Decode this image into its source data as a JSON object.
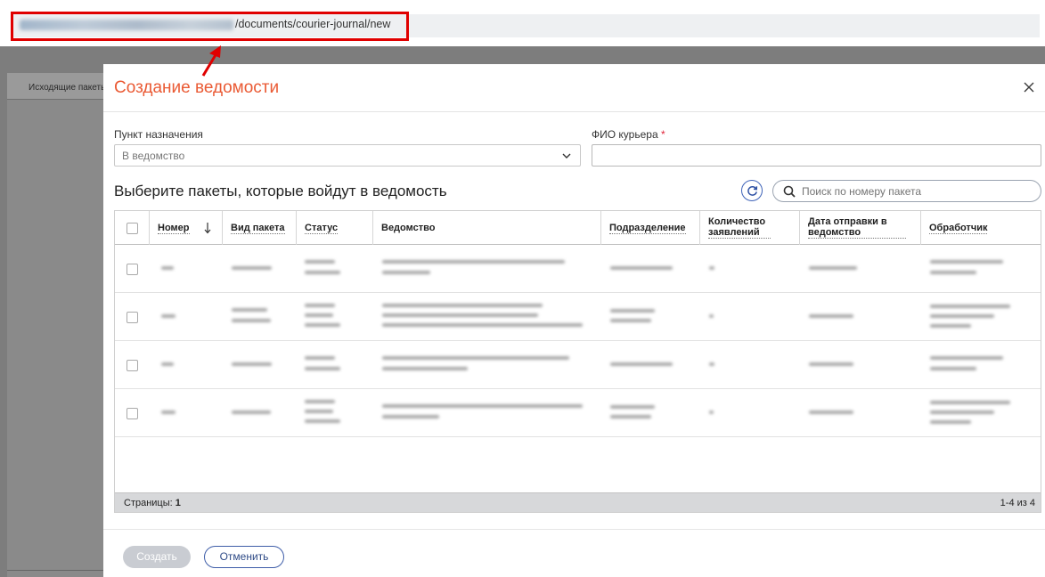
{
  "browser": {
    "url_path": "/documents/courier-journal/new"
  },
  "background": {
    "sidebar_tab_label": "Исходящие пакеты"
  },
  "modal": {
    "title": "Создание ведомости",
    "destination": {
      "label": "Пункт назначения",
      "selected_value": "В ведомство"
    },
    "courier": {
      "label": "ФИО курьера",
      "required_mark": "*",
      "value": ""
    },
    "packages_heading": "Выберите пакеты, которые войдут в ведомость",
    "search": {
      "placeholder": "Поиск по номеру пакета"
    },
    "table": {
      "columns": [
        "Номер",
        "Вид пакета",
        "Статус",
        "Ведомство",
        "Подразделение",
        "Количество заявлений",
        "Дата отправки в ведомство",
        "Обработчик"
      ],
      "rows_note": "4 rows with blurred (unreadable) content"
    },
    "pagination": {
      "pages_label": "Страницы:",
      "current_page": "1",
      "range": "1-4 из 4"
    },
    "buttons": {
      "create": "Создать",
      "cancel": "Отменить"
    }
  },
  "colors": {
    "accent_title": "#ea5a34",
    "annotation_red": "#e00000",
    "primary_blue": "#3e5da8",
    "overlay": "#7d7d7d"
  },
  "icons": [
    "close-icon",
    "chevron-down-icon",
    "refresh-icon",
    "search-icon",
    "sort-down-icon",
    "checkbox"
  ]
}
